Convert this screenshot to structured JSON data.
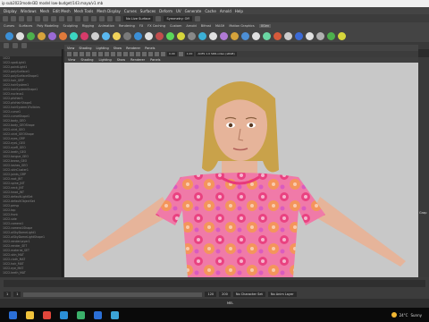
{
  "window": {
    "title": "ip sub2022model3D model low-budget/143.maya/v1.mb"
  },
  "menubar": [
    "Display",
    "Windows",
    "Mesh",
    "Edit Mesh",
    "Mesh Tools",
    "Mesh Display",
    "Curves",
    "Surfaces",
    "Deform",
    "UV",
    "Generate",
    "Cache",
    "Arnold",
    "Help"
  ],
  "toolbar": {
    "surface_dropdown": "No Live Surface",
    "symmetry_dropdown": "Symmetry: Off"
  },
  "shelf": {
    "tabs": [
      "Curves",
      "Surfaces",
      "Poly Modeling",
      "Sculpting",
      "Rigging",
      "Animation",
      "Rendering",
      "FX",
      "FX Caching",
      "Custom",
      "Arnold",
      "Bifrost",
      "MASH",
      "Motion Graphics",
      "XGen"
    ],
    "active_tab": "XGen",
    "icon_colors": [
      "#3b8fd6",
      "#e0e0e0",
      "#4db04d",
      "#d6a33b",
      "#9a6ad6",
      "#e07a3b",
      "#3bd6c2",
      "#d63b6a",
      "#cfcfcf",
      "#5ab8f0",
      "#f0d25a",
      "#7a7a7a",
      "#3b8fd6",
      "#e0e0e0",
      "#c24d4d",
      "#5ad65a",
      "#d6d63b",
      "#888888",
      "#3bb0d6",
      "#e0e0e0",
      "#b07ad6",
      "#d6a33b",
      "#4d8fd6",
      "#e0e0e0",
      "#6ad6a3",
      "#d65a3b",
      "#cccccc",
      "#3b6ad6",
      "#e0e0e0",
      "#b0b0b0",
      "#4db04d",
      "#d6d63b"
    ]
  },
  "panel_menu": [
    "View",
    "Shading",
    "Lighting",
    "Show",
    "Renderer",
    "Panels"
  ],
  "panel_tools": {
    "value_a": "0.00",
    "value_b": "1.00",
    "colorspace": "ACES 1.0 SDR-video (sRGB)"
  },
  "outliner": {
    "rows": [
      "1022",
      "1022.spotLight1",
      "1022.pointLight1",
      "1022.polySurface1",
      "1022.polySurfaceShape1",
      "1022.hair_GRP",
      "1022.hairSystem1",
      "1022.hairSystemShape1",
      "1022.nucleus1",
      "1022.pfxHair1",
      "1022.pfxHairShape1",
      "1022.hairSystem1Follicles",
      "1022.curve1",
      "1022.curveShape1",
      "1022.body_GEO",
      "1022.body_GEOShape",
      "1022.shirt_GEO",
      "1022.shirt_GEOShape",
      "1022.eyes_GRP",
      "1022.eyeL_GEO",
      "1022.eyeR_GEO",
      "1022.teeth_GEO",
      "1022.tongue_GEO",
      "1022.brows_GEO",
      "1022.lashes_GEO",
      "1022.skinCluster1",
      "1022.joints_GRP",
      "1022.root_JNT",
      "1022.spine_JNT",
      "1022.neck_JNT",
      "1022.head_JNT",
      "1022.defaultLightSet",
      "1022.defaultObjectSet",
      "1022.persp",
      "1022.top",
      "1022.front",
      "1022.side",
      "1022.camera1",
      "1022.camera1Shape",
      "1022.aiSkyDomeLight1",
      "1022.aiSkyDomeLightShape1",
      "1022.renderLayer1",
      "1022.render_SET",
      "1022.material_SET",
      "1022.skin_MAT",
      "1022.cloth_MAT",
      "1022.hair_MAT",
      "1022.eye_MAT",
      "1022.teeth_MAT"
    ]
  },
  "right_panel": {
    "label": "Grap"
  },
  "range": {
    "start": "1",
    "end": "120",
    "end2": "200",
    "character_set": "No Character Set",
    "anim_layer": "No Anim Layer"
  },
  "mel": {
    "label": "MEL"
  },
  "taskbar": {
    "app_colors": [
      "#2b6fd6",
      "#f0c23b",
      "#e0463b",
      "#2b8fd6",
      "#3bb06a",
      "#2b6fd6",
      "#3ba3d6"
    ],
    "temperature": "24°C",
    "weather": "Sunny"
  },
  "colors": {
    "shirt": "#f07aa8",
    "flower_a": "#e8397a",
    "flower_b": "#f6a23b",
    "skin": "#e6b49a",
    "hair": "#c9a24a",
    "viewport_bg": "#c8c8c8"
  }
}
